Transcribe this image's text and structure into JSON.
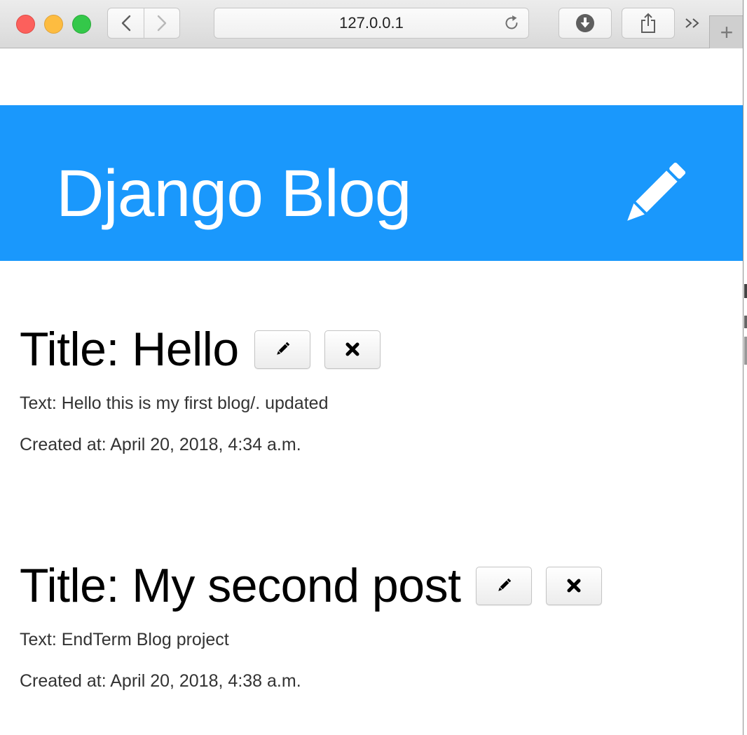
{
  "browser": {
    "url": "127.0.0.1",
    "new_tab_label": "+",
    "more_label": "»"
  },
  "header": {
    "title": "Django Blog",
    "background": "#1a98fc",
    "new_post_icon": "pencil-icon"
  },
  "posts": [
    {
      "title": "Title: Hello",
      "text": "Text: Hello this is my first blog/. updated",
      "created": "Created at: April 20, 2018, 4:34 a.m.",
      "edit_icon": "pencil-icon",
      "delete_icon": "close-icon"
    },
    {
      "title": "Title: My second post",
      "text": "Text: EndTerm Blog project",
      "created": "Created at: April 20, 2018, 4:38 a.m.",
      "edit_icon": "pencil-icon",
      "delete_icon": "close-icon"
    }
  ]
}
